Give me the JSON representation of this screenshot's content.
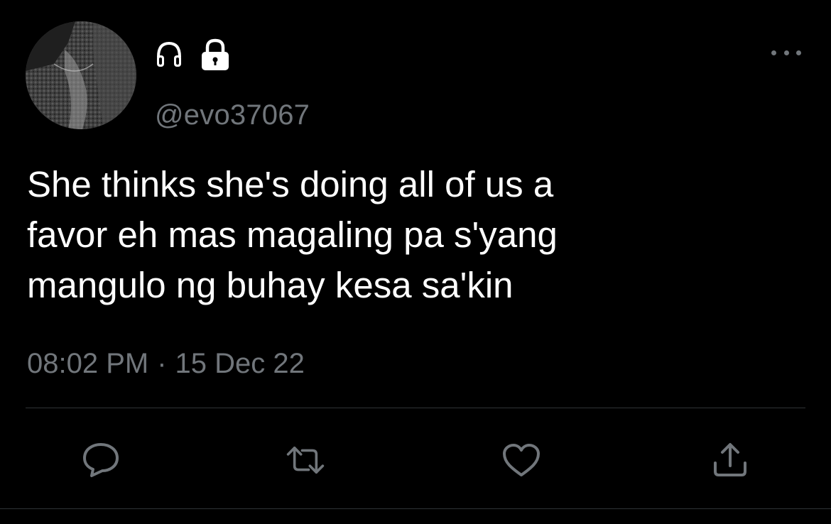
{
  "tweet": {
    "handle": "@evo37067",
    "text": "She thinks she's doing all of us a\nfavor eh mas magaling pa s'yang\nmangulo ng buhay kesa sa'kin",
    "time": "08:02 PM",
    "separator": "·",
    "date": "15 Dec 22"
  },
  "icons": {
    "name_icons": [
      "headphones-icon",
      "lock-icon"
    ],
    "more": "more-options-icon",
    "actions": [
      "reply-icon",
      "retweet-icon",
      "like-icon",
      "share-icon"
    ]
  },
  "colors": {
    "background": "#000000",
    "text": "#ffffff",
    "secondary": "#71767b",
    "divider": "#2f3336"
  }
}
